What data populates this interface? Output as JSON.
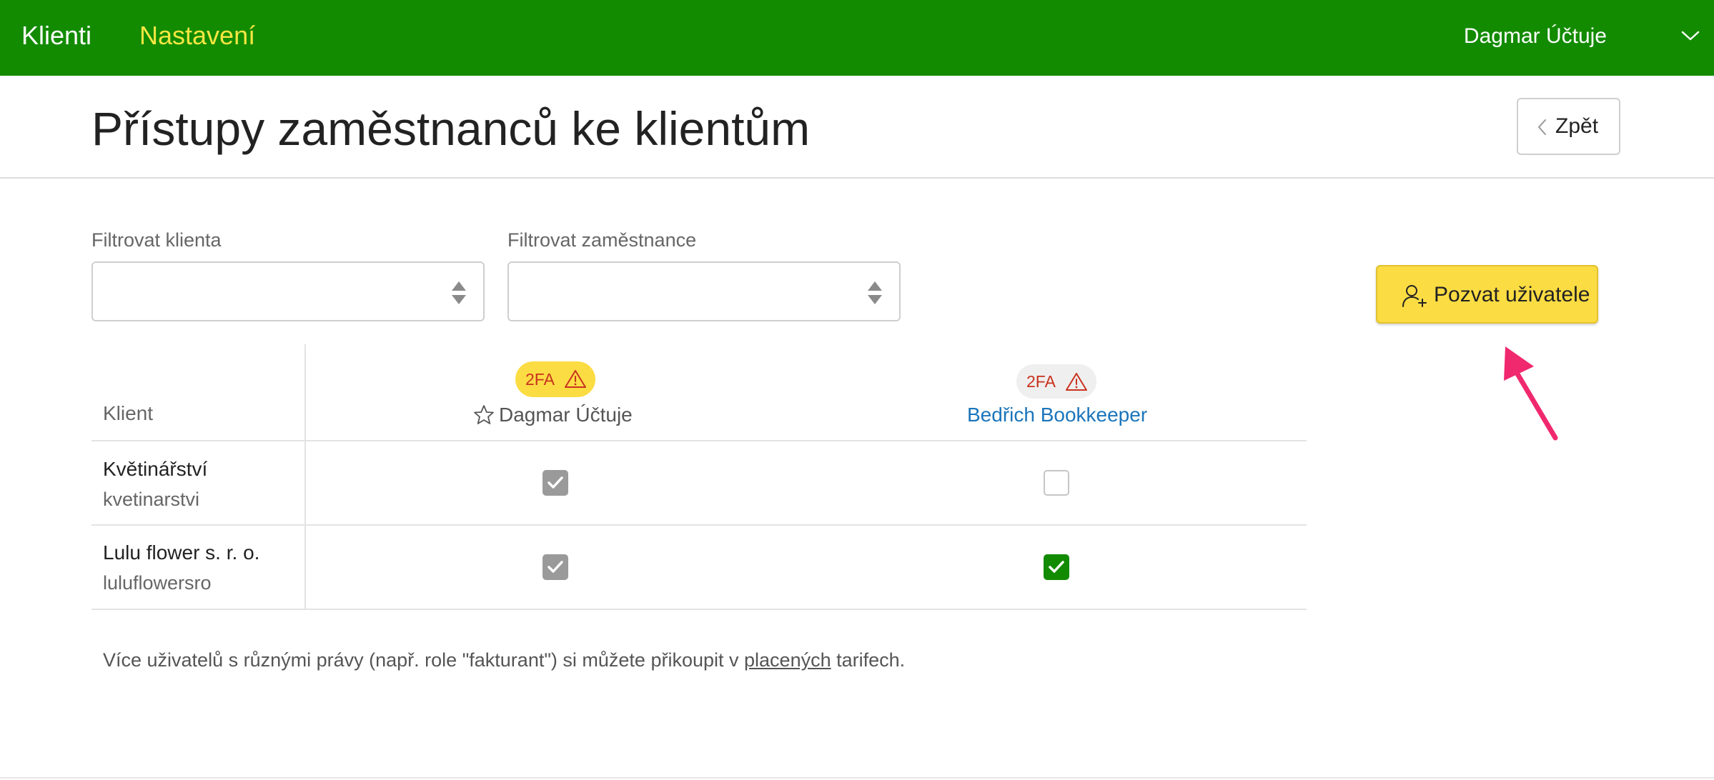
{
  "topbar": {
    "nav": [
      {
        "label": "Klienti"
      },
      {
        "label": "Nastavení"
      }
    ],
    "user_name": "Dagmar Účtuje",
    "icons": {
      "user_menu": "chevron-down-icon"
    },
    "colors": {
      "bar": "#138b00",
      "active_nav": "#f5e642"
    }
  },
  "header": {
    "title": "Přístupy zaměstnanců ke klientům",
    "back_label": "Zpět"
  },
  "filters": {
    "client_label": "Filtrovat klienta",
    "client_value": "",
    "employee_label": "Filtrovat zaměstnance",
    "employee_value": ""
  },
  "invite": {
    "label": "Pozvat uživatele",
    "icon": "user-plus-icon",
    "color": "#fcdc43"
  },
  "table": {
    "client_header": "Klient",
    "employees": [
      {
        "badge": "2FA",
        "name": "Dagmar Účtuje",
        "icon": "star-icon",
        "badge_color": "#fcdc43"
      },
      {
        "badge": "2FA",
        "name": "Bedřich Bookkeeper",
        "badge_color": "#efefef"
      }
    ],
    "rows": [
      {
        "name": "Květinářství",
        "slug": "kvetinarstvi",
        "access": [
          "checked-disabled",
          "unchecked"
        ]
      },
      {
        "name": "Lulu flower s. r. o.",
        "slug": "luluflowersro",
        "access": [
          "checked-disabled",
          "checked"
        ]
      }
    ]
  },
  "footnote": {
    "before": "Více uživatelů s různými právy (např. role \"fakturant\") si můžete přikoupit v ",
    "link": "placených",
    "after": " tarifech."
  }
}
